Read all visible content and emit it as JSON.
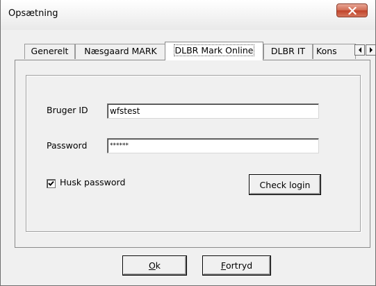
{
  "window": {
    "title": "Opsætning",
    "close_glyph": "X"
  },
  "tabs": [
    {
      "label": "Generelt"
    },
    {
      "label": "Næsgaard MARK"
    },
    {
      "label": "DLBR Mark Online",
      "active": true
    },
    {
      "label": "DLBR IT"
    },
    {
      "label": "Kons"
    }
  ],
  "tab_scroll": {
    "left_icon": "arrow-left-icon",
    "right_icon": "arrow-right-icon"
  },
  "form": {
    "user_label": "Bruger ID",
    "user_value": "wfstest",
    "password_label": "Password",
    "password_value": "******",
    "remember_label": "Husk password",
    "remember_checked": true,
    "check_login_label": "Check login"
  },
  "buttons": {
    "ok_mnemonic": "O",
    "ok_rest": "k",
    "cancel_mnemonic": "F",
    "cancel_rest": "ortryd"
  }
}
